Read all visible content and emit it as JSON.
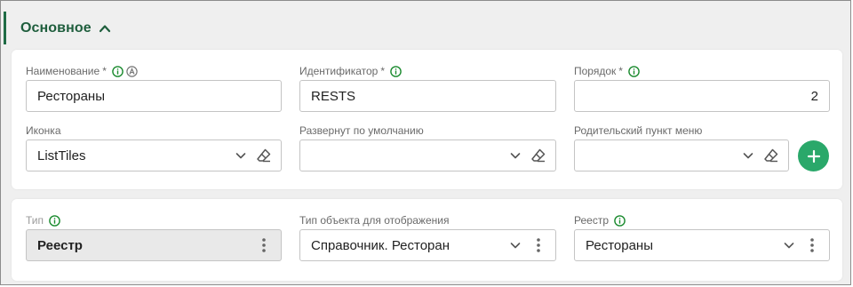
{
  "section": {
    "title": "Основное",
    "collapse_icon": "chevron-up-icon"
  },
  "row1": {
    "name": {
      "label": "Наименование",
      "required": "*",
      "value": "Рестораны"
    },
    "identifier": {
      "label": "Идентификатор",
      "required": "*",
      "value": "RESTS"
    },
    "order": {
      "label": "Порядок",
      "required": "*",
      "value": "2"
    }
  },
  "row2": {
    "icon": {
      "label": "Иконка",
      "value": "ListTiles"
    },
    "expanded": {
      "label": "Развернут по умолчанию",
      "value": ""
    },
    "parent": {
      "label": "Родительский пункт меню",
      "value": ""
    }
  },
  "row3": {
    "type": {
      "label": "Тип",
      "value": "Реестр"
    },
    "object_type": {
      "label": "Тип объекта для отображения",
      "value": "Справочник. Ресторан"
    },
    "registry": {
      "label": "Реестр",
      "value": "Рестораны"
    }
  },
  "colors": {
    "accent_green": "#1f6b45",
    "add_button": "#2aa86a",
    "info_icon": "#1a8a2e"
  },
  "icons": [
    "info-icon",
    "auto-icon",
    "chevron-down-icon",
    "eraser-icon",
    "plus-icon",
    "more-vertical-icon"
  ]
}
